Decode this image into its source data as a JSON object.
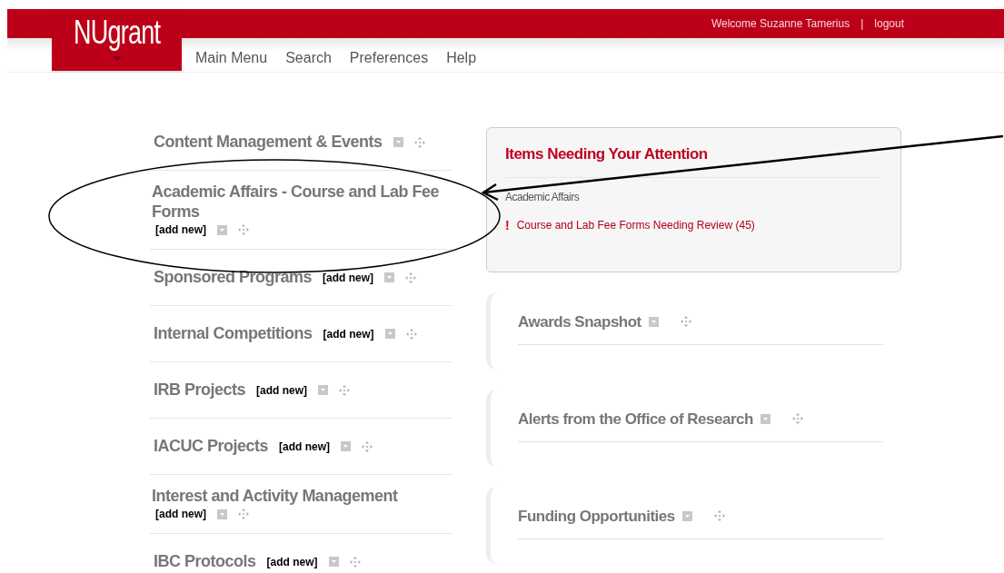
{
  "header": {
    "logo": "NUgrant",
    "welcome": "Welcome Suzanne Tamerius",
    "separator": "|",
    "logout": "logout"
  },
  "nav": [
    "Main Menu",
    "Search",
    "Preferences",
    "Help"
  ],
  "left_widgets": [
    {
      "title": "Content Management & Events",
      "kind": "inline"
    },
    {
      "title": " Academic Affairs - Course and Lab Fee Forms",
      "add_new": "[add new]",
      "kind": "stacked"
    },
    {
      "title": "Sponsored Programs",
      "add_new": "[add new]",
      "kind": "inline"
    },
    {
      "title": "Internal Competitions",
      "add_new": "[add new]",
      "kind": "inline"
    },
    {
      "title": "IRB Projects",
      "add_new": "[add new]",
      "kind": "inline"
    },
    {
      "title": "IACUC Projects",
      "add_new": "[add new]",
      "kind": "inline"
    },
    {
      "title": "Interest and Activity Management",
      "add_new": "[add new]",
      "kind": "stacked"
    },
    {
      "title": "IBC Protocols",
      "add_new": "[add new]",
      "kind": "inline"
    }
  ],
  "attention_panel": {
    "title": "Items Needing Your Attention",
    "section": "Academic Affairs",
    "alerts": [
      {
        "icon": "!",
        "text": "Course and Lab Fee Forms Needing Review (45)"
      }
    ]
  },
  "right_widgets": [
    {
      "title": "Awards Snapshot"
    },
    {
      "title": "Alerts from the Office of Research"
    },
    {
      "title": "Funding Opportunities"
    }
  ]
}
